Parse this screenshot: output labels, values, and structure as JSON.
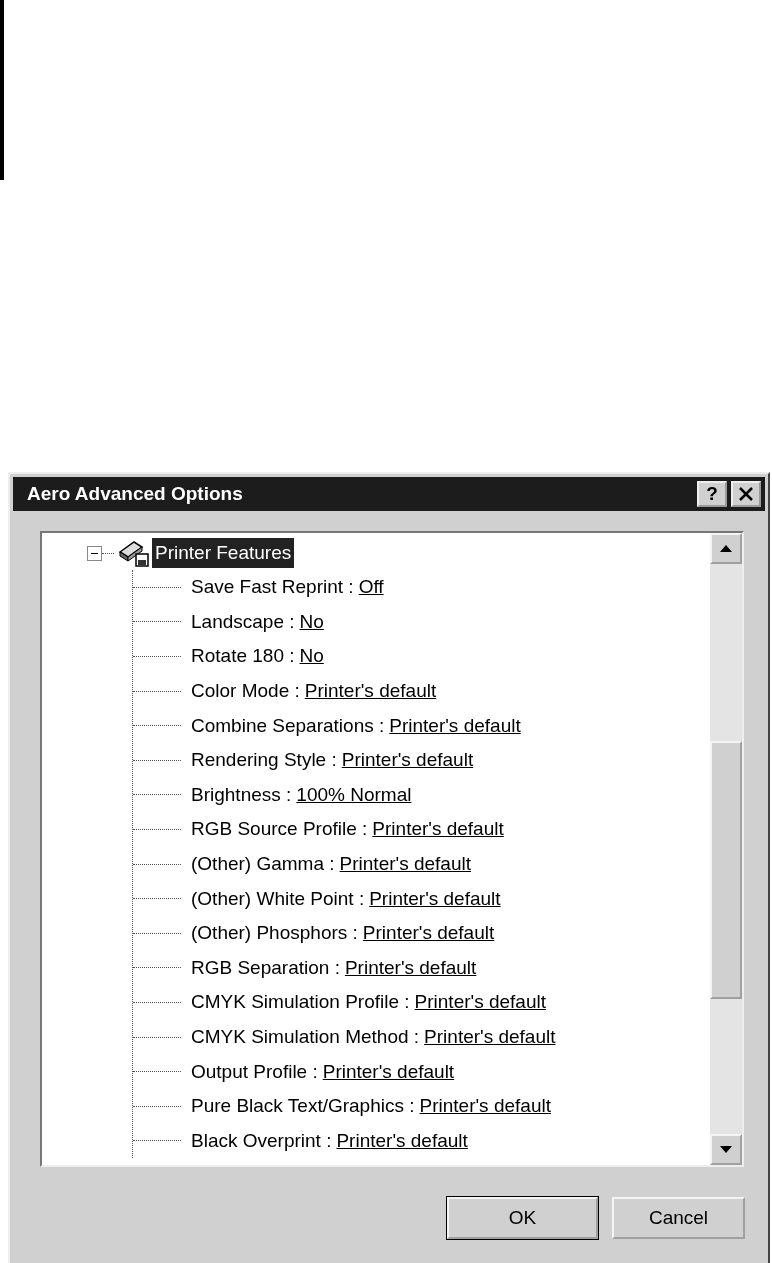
{
  "window": {
    "title": "Aero Advanced Options",
    "help_button": "?"
  },
  "tree": {
    "label": "Printer Features",
    "selected": true,
    "expanded": true,
    "children": [
      {
        "label": "Save Fast Reprint :",
        "value": "Off"
      },
      {
        "label": "Landscape :",
        "value": "No"
      },
      {
        "label": "Rotate 180 :",
        "value": "No"
      },
      {
        "label": "Color Mode :",
        "value": "Printer's default"
      },
      {
        "label": "Combine Separations :",
        "value": "Printer's default"
      },
      {
        "label": "Rendering Style :",
        "value": "Printer's default"
      },
      {
        "label": "Brightness :",
        "value": "100% Normal"
      },
      {
        "label": "RGB Source Profile :",
        "value": "Printer's default"
      },
      {
        "label": "(Other) Gamma :",
        "value": "Printer's default"
      },
      {
        "label": "(Other) White Point :",
        "value": "Printer's default"
      },
      {
        "label": "(Other) Phosphors :",
        "value": "Printer's default"
      },
      {
        "label": "RGB Separation :",
        "value": "Printer's default"
      },
      {
        "label": "CMYK Simulation Profile :",
        "value": "Printer's default"
      },
      {
        "label": "CMYK Simulation Method :",
        "value": "Printer's default"
      },
      {
        "label": "Output Profile :",
        "value": "Printer's default"
      },
      {
        "label": "Pure Black Text/Graphics :",
        "value": "Printer's default"
      },
      {
        "label": "Black Overprint :",
        "value": "Printer's default"
      }
    ]
  },
  "buttons": [
    "OK",
    "Cancel"
  ]
}
